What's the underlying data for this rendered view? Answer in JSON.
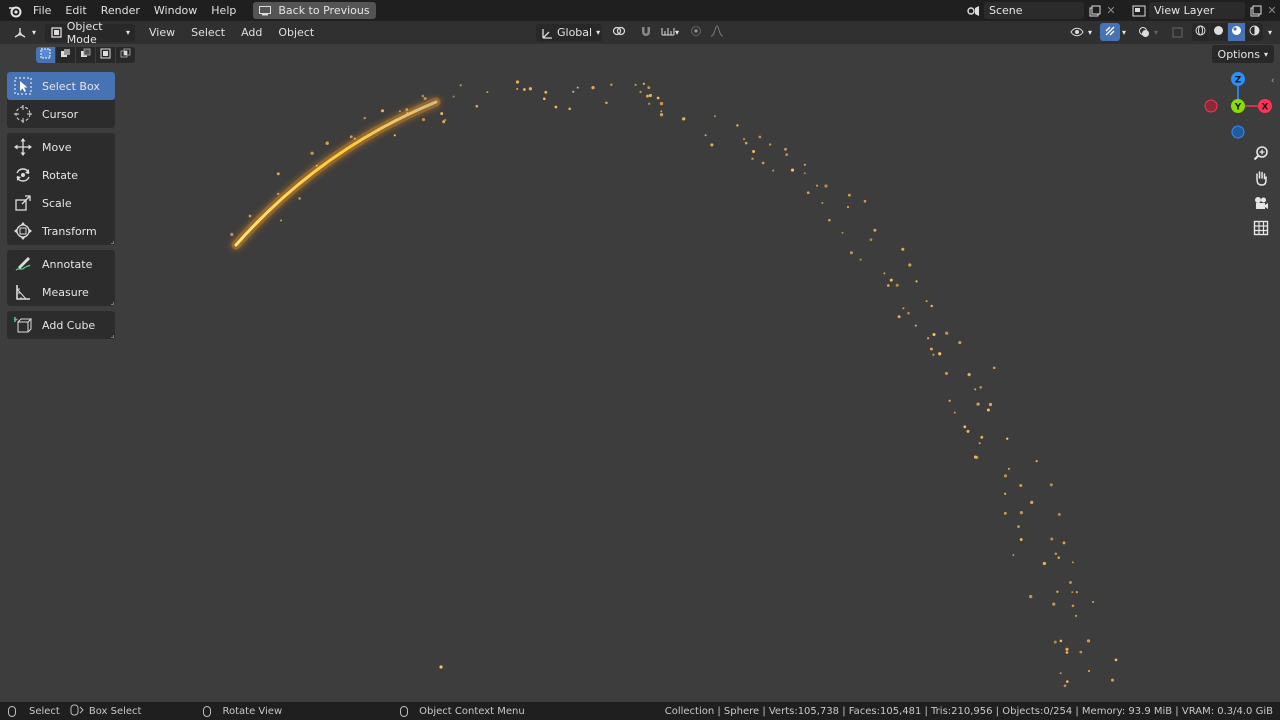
{
  "topbar": {
    "menus": [
      "File",
      "Edit",
      "Render",
      "Window",
      "Help"
    ],
    "back_button": "Back to Previous",
    "scene": "Scene",
    "view_layer": "View Layer"
  },
  "header": {
    "mode": "Object Mode",
    "menus": [
      "View",
      "Select",
      "Add",
      "Object"
    ],
    "transform_orientation": "Global"
  },
  "options_label": "Options",
  "toolbar": {
    "tools": [
      {
        "label": "Select Box",
        "icon": "select-box-icon",
        "active": true
      },
      {
        "label": "Cursor",
        "icon": "cursor-icon"
      },
      {
        "label": "Move",
        "icon": "move-icon"
      },
      {
        "label": "Rotate",
        "icon": "rotate-icon"
      },
      {
        "label": "Scale",
        "icon": "scale-icon"
      },
      {
        "label": "Transform",
        "icon": "transform-icon"
      },
      {
        "label": "Annotate",
        "icon": "annotate-icon"
      },
      {
        "label": "Measure",
        "icon": "measure-icon"
      },
      {
        "label": "Add Cube",
        "icon": "add-cube-icon"
      }
    ]
  },
  "gizmo": {
    "x": "X",
    "y": "Y",
    "z": "Z"
  },
  "colors": {
    "accent": "#4772b3",
    "particle": "#ffb347",
    "axis_x": "#ff3352",
    "axis_y": "#8bdc00",
    "axis_z": "#2890ff"
  },
  "statusbar": {
    "select": "Select",
    "box_select": "Box Select",
    "rotate_view": "Rotate View",
    "context_menu": "Object Context Menu",
    "stats": "Collection | Sphere | Verts:105,738 | Faces:105,481 | Tris:210,956 | Objects:0/254 | Memory: 93.9 MiB | VRAM: 0.3/4.0 GiB"
  }
}
